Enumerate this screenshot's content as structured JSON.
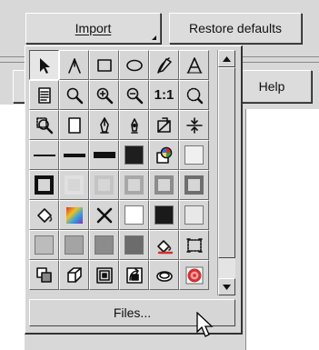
{
  "toolbar": {
    "import_label": "Import",
    "restore_label": "Restore defaults",
    "help_label": "Help"
  },
  "popup": {
    "files_label": "Files...",
    "rows": [
      [
        {
          "name": "pointer-tool-icon",
          "kind": "icon",
          "selected": true
        },
        {
          "name": "shape-tool-icon",
          "kind": "icon"
        },
        {
          "name": "rectangle-tool-icon",
          "kind": "icon"
        },
        {
          "name": "ellipse-tool-icon",
          "kind": "icon"
        },
        {
          "name": "freehand-tool-icon",
          "kind": "icon"
        },
        {
          "name": "text-tool-icon",
          "kind": "icon"
        }
      ],
      [
        {
          "name": "document-icon",
          "kind": "icon"
        },
        {
          "name": "zoom-icon",
          "kind": "icon"
        },
        {
          "name": "zoom-in-icon",
          "kind": "icon"
        },
        {
          "name": "zoom-out-icon",
          "kind": "icon"
        },
        {
          "name": "actual-size-icon",
          "kind": "text",
          "text": "1:1"
        },
        {
          "name": "zoom-all-icon",
          "kind": "icon"
        }
      ],
      [
        {
          "name": "zoom-selected-icon",
          "kind": "icon"
        },
        {
          "name": "page-icon",
          "kind": "icon"
        },
        {
          "name": "pen-outline-icon",
          "kind": "icon"
        },
        {
          "name": "pen-tip-icon",
          "kind": "icon"
        },
        {
          "name": "transform-icon",
          "kind": "icon"
        },
        {
          "name": "align-center-icon",
          "kind": "icon"
        }
      ],
      [
        {
          "name": "thin-line-icon",
          "kind": "line",
          "weight": 2
        },
        {
          "name": "medium-line-icon",
          "kind": "line",
          "weight": 4
        },
        {
          "name": "thick-line-icon",
          "kind": "line",
          "weight": 7
        },
        {
          "name": "heavy-line-icon",
          "kind": "swatch",
          "color": "#1e1e1e"
        },
        {
          "name": "color-palette-icon",
          "kind": "icon"
        },
        {
          "name": "white-swatch-icon",
          "kind": "swatch",
          "color": "#f0f0f0"
        }
      ],
      [
        {
          "name": "outline-black-icon",
          "kind": "frame",
          "color": "#111111"
        },
        {
          "name": "outline-light-icon",
          "kind": "frame",
          "color": "#e0e0e0"
        },
        {
          "name": "outline-silver-icon",
          "kind": "frame",
          "color": "#c4c4c4"
        },
        {
          "name": "outline-gray-icon",
          "kind": "frame",
          "color": "#a8a8a8"
        },
        {
          "name": "outline-darkgray-icon",
          "kind": "frame",
          "color": "#8c8c8c"
        },
        {
          "name": "outline-dim-icon",
          "kind": "frame",
          "color": "#6e6e6e"
        }
      ],
      [
        {
          "name": "fill-bucket-icon",
          "kind": "icon"
        },
        {
          "name": "gradient-fill-icon",
          "kind": "icon"
        },
        {
          "name": "no-fill-icon",
          "kind": "icon"
        },
        {
          "name": "white-fill-icon",
          "kind": "swatch",
          "color": "#ffffff"
        },
        {
          "name": "black-fill-icon",
          "kind": "swatch",
          "color": "#1a1a1a"
        },
        {
          "name": "light-fill-icon",
          "kind": "swatch",
          "color": "#e8e8e8"
        }
      ],
      [
        {
          "name": "gray-fill-1-icon",
          "kind": "swatch",
          "color": "#bcbcbc"
        },
        {
          "name": "gray-fill-2-icon",
          "kind": "swatch",
          "color": "#a4a4a4"
        },
        {
          "name": "gray-fill-3-icon",
          "kind": "swatch",
          "color": "#8c8c8c"
        },
        {
          "name": "gray-fill-4-icon",
          "kind": "swatch",
          "color": "#6c6c6c"
        },
        {
          "name": "fill-color-icon",
          "kind": "icon"
        },
        {
          "name": "fill-pattern-icon",
          "kind": "icon"
        }
      ],
      [
        {
          "name": "copy-object-icon",
          "kind": "icon"
        },
        {
          "name": "extrude-icon",
          "kind": "icon"
        },
        {
          "name": "contour-icon",
          "kind": "icon"
        },
        {
          "name": "envelope-icon",
          "kind": "icon"
        },
        {
          "name": "lens-icon",
          "kind": "icon"
        },
        {
          "name": "red-target-icon",
          "kind": "icon"
        }
      ]
    ]
  },
  "colors": {
    "dialog_bg": "#d8d8d8",
    "popup_bg": "#d6d6d6",
    "accent_red": "#d03030"
  }
}
